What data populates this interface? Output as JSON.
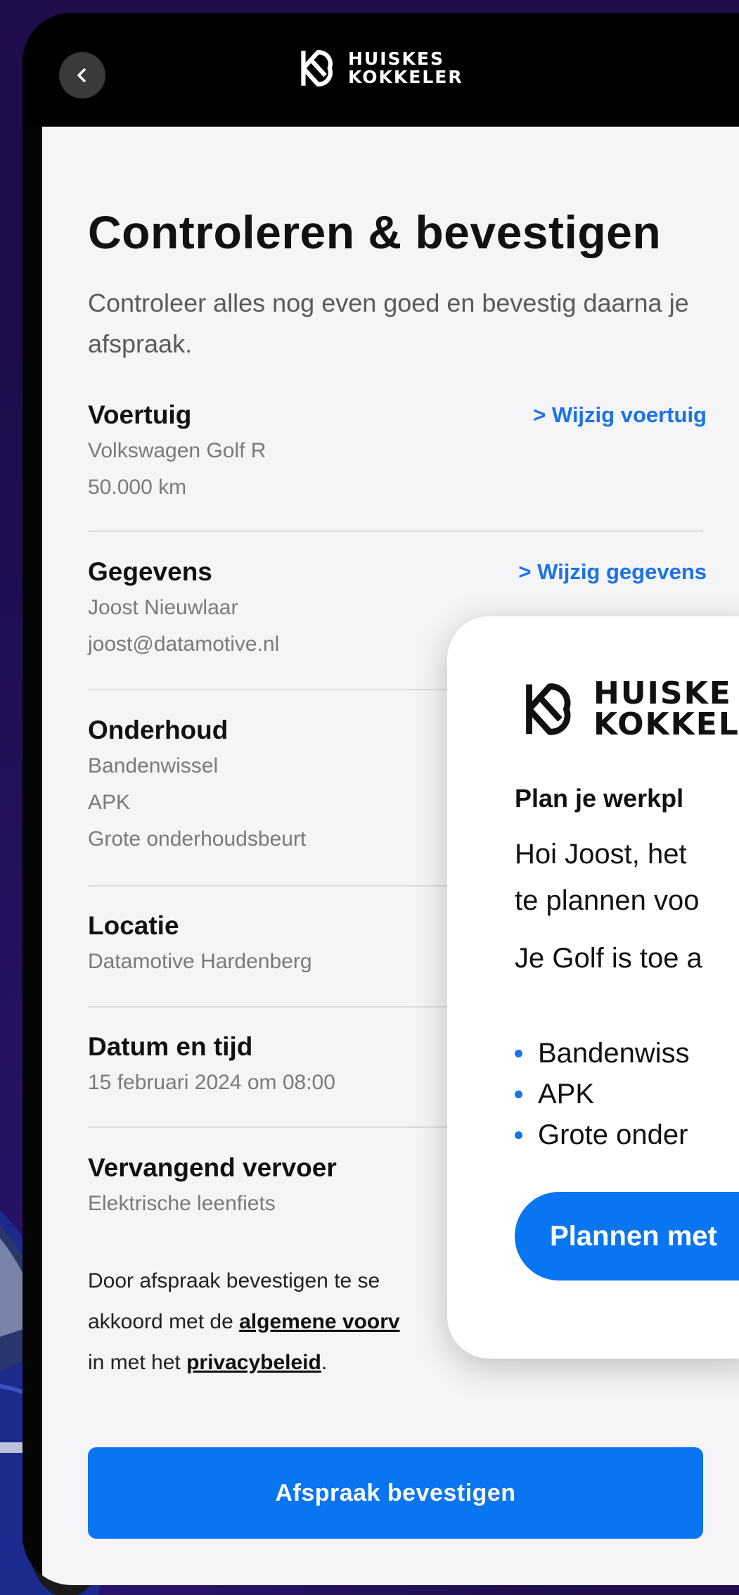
{
  "brand": {
    "line1": "HUISKES",
    "line2": "KOKKELER"
  },
  "page": {
    "title": "Controleren & bevestigen",
    "intro": "Controleer alles nog even goed en bevestig daarna je afspraak."
  },
  "sections": {
    "vehicle": {
      "title": "Voertuig",
      "lines": [
        "Volkswagen Golf R",
        "50.000 km"
      ],
      "edit": "Wijzig voertuig"
    },
    "details": {
      "title": "Gegevens",
      "lines": [
        "Joost Nieuwlaar",
        "joost@datamotive.nl"
      ],
      "edit": "Wijzig gegevens"
    },
    "maintenance": {
      "title": "Onderhoud",
      "lines": [
        "Bandenwissel",
        "APK",
        "Grote onderhoudsbeurt"
      ]
    },
    "location": {
      "title": "Locatie",
      "lines": [
        "Datamotive Hardenberg"
      ]
    },
    "datetime": {
      "title": "Datum en tijd",
      "lines": [
        "15 februari 2024 om 08:00"
      ]
    },
    "replacement": {
      "title": "Vervangend vervoer",
      "lines": [
        "Elektrische leenfiets"
      ]
    }
  },
  "terms": {
    "line1": "Door afspraak bevestigen te se",
    "line2_prefix": "akkoord met de ",
    "line2_link": "algemene voorv",
    "line3_prefix": "in met het ",
    "line3_link": "privacybeleid",
    "line3_suffix": "."
  },
  "confirm_button": "Afspraak bevestigen",
  "card": {
    "brand_line1": "HUISKE",
    "brand_line2": "KOKKEL",
    "heading": "Plan je werkpl",
    "text1": "Hoi Joost, het",
    "text2": "te plannen voo",
    "text3": "Je Golf is toe a",
    "items": [
      "Bandenwiss",
      "APK",
      "Grote onder"
    ],
    "button": "Plannen met"
  },
  "colors": {
    "accent": "#0a75f0",
    "link": "#1a73e8",
    "background": "#1e0d4a"
  },
  "icons": {
    "back": "chevron-left-icon",
    "logo": "huiskes-kokkeler-logo",
    "link_arrow": "chevron-right-icon"
  }
}
